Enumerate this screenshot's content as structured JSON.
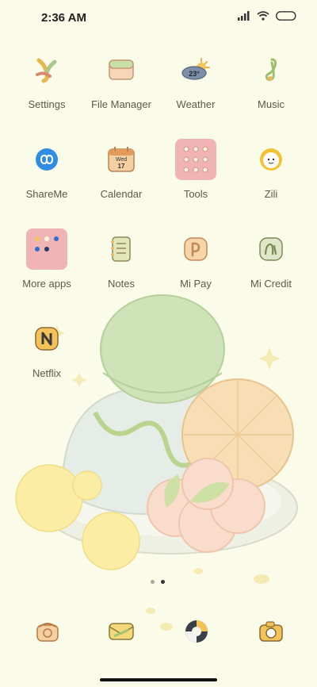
{
  "status": {
    "time": "2:36 AM"
  },
  "apps": [
    {
      "label": "Settings"
    },
    {
      "label": "File Manager"
    },
    {
      "label": "Weather",
      "temp": "23°"
    },
    {
      "label": "Music"
    },
    {
      "label": "ShareMe"
    },
    {
      "label": "Calendar",
      "day": "Wed",
      "date": "17"
    },
    {
      "label": "Tools"
    },
    {
      "label": "Zili"
    },
    {
      "label": "More apps"
    },
    {
      "label": "Notes"
    },
    {
      "label": "Mi Pay"
    },
    {
      "label": "Mi Credit"
    },
    {
      "label": "Netflix"
    }
  ],
  "pages": {
    "count": 2,
    "current": 2
  },
  "dock": [
    "phone-icon",
    "messages-icon",
    "browser-icon",
    "camera-icon"
  ]
}
